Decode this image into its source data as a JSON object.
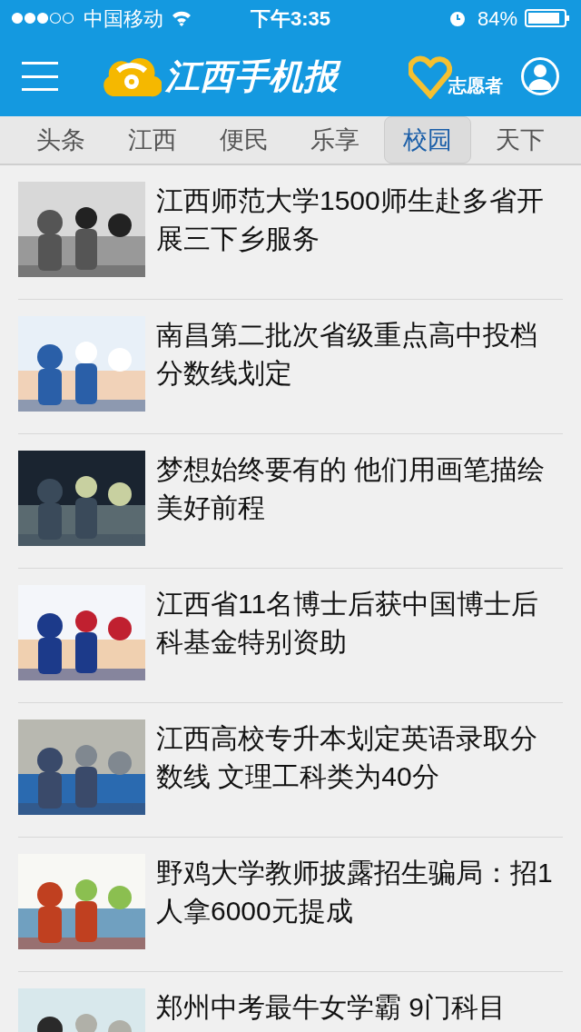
{
  "status_bar": {
    "carrier": "中国移动",
    "time": "下午3:35",
    "battery": "84%"
  },
  "header": {
    "logo": "江西手机报",
    "volunteer": "志愿者"
  },
  "tabs": [
    {
      "label": "头条",
      "selected": false
    },
    {
      "label": "江西",
      "selected": false
    },
    {
      "label": "便民",
      "selected": false
    },
    {
      "label": "乐享",
      "selected": false
    },
    {
      "label": "校园",
      "selected": true
    },
    {
      "label": "天下",
      "selected": false
    }
  ],
  "articles": [
    {
      "title": "江西师范大学1500师生赴多省开展三下乡服务"
    },
    {
      "title": "南昌第二批次省级重点高中投档分数线划定"
    },
    {
      "title": "梦想始终要有的 他们用画笔描绘美好前程"
    },
    {
      "title": "江西省11名博士后获中国博士后科基金特别资助"
    },
    {
      "title": "江西高校专升本划定英语录取分数线 文理工科类为40分"
    },
    {
      "title": "野鸡大学教师披露招生骗局：招1人拿6000元提成"
    },
    {
      "title": "郑州中考最牛女学霸 9门科目"
    }
  ]
}
